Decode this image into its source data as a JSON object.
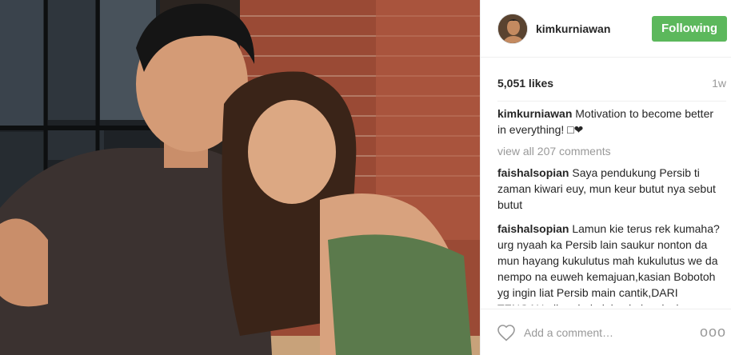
{
  "post": {
    "username": "kimkurniawan",
    "follow_label": "Following",
    "likes": "5,051 likes",
    "time": "1w",
    "caption": {
      "user": "kimkurniawan",
      "text": "Motivation to become better in everything! □❤"
    },
    "view_all": "view all 207 comments",
    "comments": [
      {
        "user": "faishalsopian",
        "text": "Saya pendukung Persib ti zaman kiwari euy, mun keur butut nya sebut butut"
      },
      {
        "user": "faishalsopian",
        "text": "Lamun kie terus rek kumaha?urg nyaah ka Persib lain saukur nonton da mun hayang kukulutus mah kukulutus we da nempo na euweh kemajuan,kasian Bobotoh yg ingin liat Persib main cantik,DARI TENGAH aliran bola jalan kalo misalnya buntu dari"
      }
    ],
    "comment_placeholder": "Add a comment…",
    "more_label": "ooo"
  },
  "colors": {
    "follow_button": "#5cb85c",
    "muted_text": "#999999",
    "divider": "#efefef"
  },
  "icons": {
    "like": "heart-icon",
    "more": "more-options-icon"
  }
}
